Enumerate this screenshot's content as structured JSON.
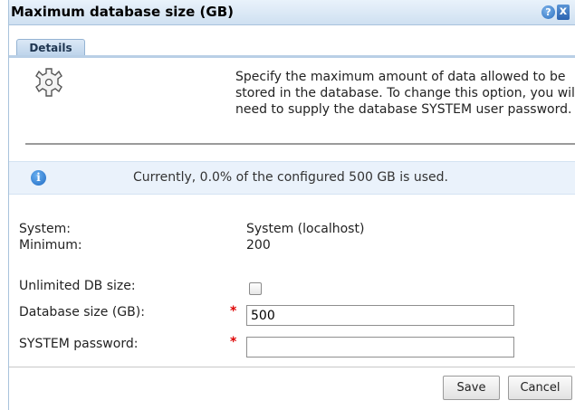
{
  "window": {
    "title": "Maximum database size (GB)",
    "help_glyph": "?",
    "close_glyph": "x"
  },
  "tabs": [
    {
      "label": "Details"
    }
  ],
  "description": "Specify the maximum amount of data allowed to be stored in the database. To change this option, you will need to supply the database SYSTEM user password.",
  "info": {
    "icon": "info-icon",
    "glyph": "i",
    "text": "Currently, 0.0% of the configured 500 GB is used."
  },
  "fields": {
    "system_label": "System:",
    "system_value": "System (localhost)",
    "minimum_label": "Minimum:",
    "minimum_value": "200",
    "unlimited_label": "Unlimited DB size:",
    "unlimited_checked": false,
    "dbsize_label": "Database size (GB):",
    "dbsize_value": "500",
    "password_label": "SYSTEM password:",
    "password_value": "",
    "required_marker": "*"
  },
  "buttons": {
    "save": "Save",
    "cancel": "Cancel"
  },
  "colors": {
    "title_bar": "#cfe0f1",
    "info_bar": "#eaf2fb",
    "required": "#dd0000"
  }
}
